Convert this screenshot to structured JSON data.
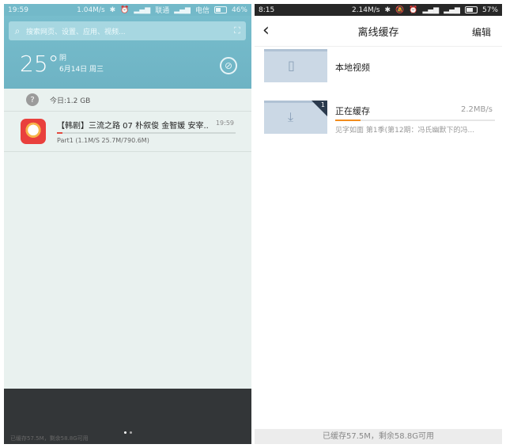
{
  "left": {
    "status": {
      "time": "19:59",
      "net_speed": "1.04M/s",
      "icons": [
        "bluetooth-icon",
        "alarm-icon",
        "signal-icon"
      ],
      "carrier1": "联通",
      "carrier2": "电信",
      "battery": "46%"
    },
    "search": {
      "placeholder": "搜索网页、设置、应用、视频..."
    },
    "weather": {
      "temperature": "25°",
      "condition": "阴",
      "date": "6月14日 周三"
    },
    "today_usage": "今日:1.2 GB",
    "download": {
      "title": "【韩剧】三流之路 07 朴叙俊 金智媛 安宰..",
      "time": "19:59",
      "progress": 0.033,
      "meta": "Part1 (1.1M/S   25.7M/790.6M)"
    },
    "ghost_text": "已缓存57.5M，剩余58.8G可用"
  },
  "right": {
    "status": {
      "time": "8:15",
      "net_speed": "2.14M/s",
      "battery": "57%"
    },
    "nav": {
      "title": "离线缓存",
      "edit": "编辑"
    },
    "local_video": {
      "label": "本地视频"
    },
    "caching": {
      "label": "正在缓存",
      "speed": "2.2MB/s",
      "badge": "1",
      "progress": 0.16,
      "subtitle": "见字如面 第1季(第12期：冯氏幽默下的冯..."
    },
    "footer": "已缓存57.5M，剩余58.8G可用"
  },
  "colors": {
    "left_header": "#73b9c9",
    "accent_red": "#e44a3f",
    "accent_orange": "#f28c1d",
    "folder": "#cbd8e5"
  }
}
